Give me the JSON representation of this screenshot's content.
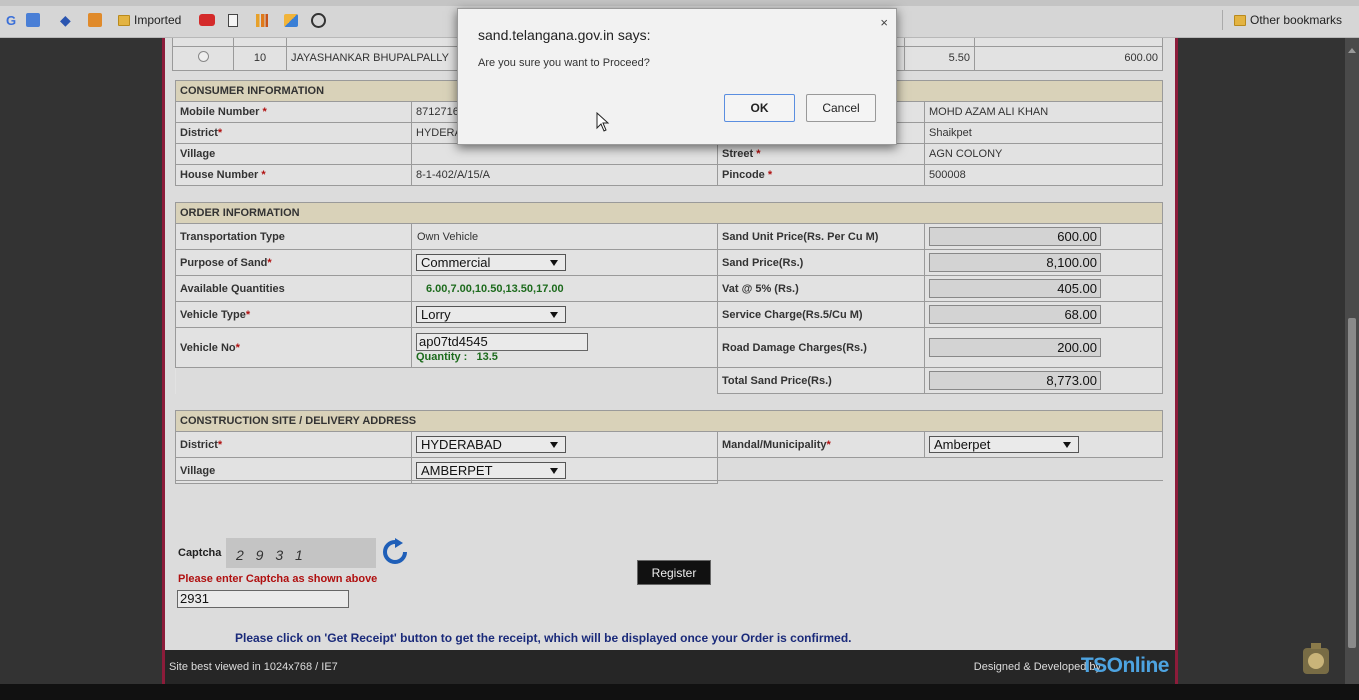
{
  "bookmarks": {
    "imported_label": "Imported",
    "other_label": "Other bookmarks"
  },
  "top_row": {
    "index": "10",
    "district": "JAYASHANKAR BHUPALPALLY",
    "qty": "5.50",
    "price": "600.00"
  },
  "consumer": {
    "header": "CONSUMER INFORMATION",
    "mobile_label": "Mobile Number",
    "mobile_value": "8712716",
    "name_value": "MOHD AZAM ALI KHAN",
    "district_label": "District",
    "district_value": "HYDERA",
    "mandal_value": "Shaikpet",
    "village_label": "Village",
    "village_value": "",
    "street_label": "Street",
    "street_value": "AGN COLONY",
    "house_label": "House Number",
    "house_value": "8-1-402/A/15/A",
    "pincode_label": "Pincode",
    "pincode_value": "500008"
  },
  "order": {
    "header": "ORDER INFORMATION",
    "transport_label": "Transportation Type",
    "transport_value": "Own Vehicle",
    "unit_price_label": "Sand Unit Price(Rs. Per Cu M)",
    "unit_price_value": "600.00",
    "purpose_label": "Purpose of Sand",
    "purpose_value": "Commercial",
    "sand_price_label": "Sand Price(Rs.)",
    "sand_price_value": "8,100.00",
    "avail_label": "Available Quantities",
    "avail_value": "6.00,7.00,10.50,13.50,17.00",
    "vat_label": "Vat @ 5% (Rs.)",
    "vat_value": "405.00",
    "vehicle_type_label": "Vehicle Type",
    "vehicle_type_value": "Lorry",
    "service_label": "Service Charge(Rs.5/Cu M)",
    "service_value": "68.00",
    "vehicle_no_label": "Vehicle No",
    "vehicle_no_value": "ap07td4545",
    "quantity_label": "Quantity :",
    "quantity_value": "13.5",
    "road_label": "Road Damage Charges(Rs.)",
    "road_value": "200.00",
    "total_label": "Total Sand Price(Rs.)",
    "total_value": "8,773.00"
  },
  "site": {
    "header": "CONSTRUCTION SITE / DELIVERY ADDRESS",
    "district_label": "District",
    "district_value": "HYDERABAD",
    "mandal_label": "Mandal/Municipality",
    "mandal_value": "Amberpet",
    "village_label": "Village",
    "village_value": "AMBERPET"
  },
  "captcha": {
    "label": "Captcha",
    "image_text": "2 9 3 1",
    "hint": "Please enter Captcha as shown above",
    "input_value": "2931"
  },
  "register_label": "Register",
  "notice": "Please click on 'Get Receipt' button to get the receipt, which will be displayed once your Order is confirmed.",
  "footer": {
    "left": "Site best viewed in 1024x768 / IE7",
    "right": "Designed & Developed by",
    "logo": "TSOnline"
  },
  "dialog": {
    "title": "sand.telangana.gov.in says:",
    "message": "Are you sure you want to Proceed?",
    "ok": "OK",
    "cancel": "Cancel",
    "close": "×"
  },
  "required_mark": "*"
}
